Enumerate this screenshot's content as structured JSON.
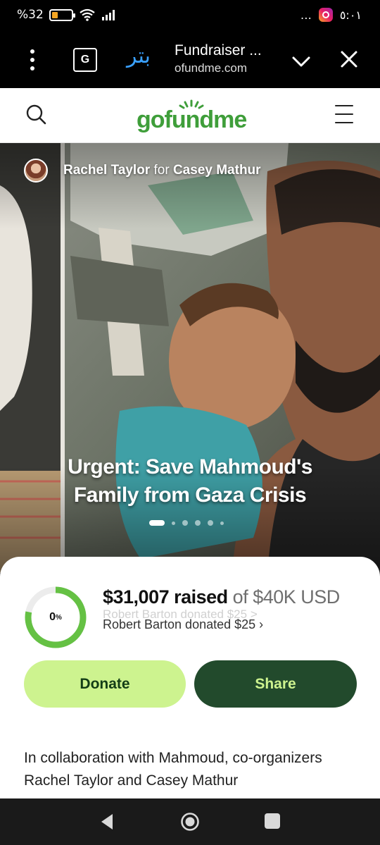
{
  "status_bar": {
    "battery": "%32",
    "battery_level": 0.32,
    "time": "٥:٠١",
    "overflow": "…"
  },
  "browser": {
    "site_logo": "بتر",
    "tab_title": "Fundraiser ...",
    "url": "ofundme.com",
    "translate_glyph": "G"
  },
  "site_header": {
    "logo_text": "gofundme"
  },
  "hero": {
    "organizer": "Rachel Taylor",
    "for_label": "for",
    "beneficiary": "Casey Mathur",
    "title_line1": "Urgent: Save Mahmoud's",
    "title_line2": "Family from Gaza Crisis",
    "slide_count": 6,
    "active_slide": 1
  },
  "progress": {
    "percent_label": "0",
    "percent_sign": "%",
    "ring_fill_fraction": 0.78,
    "raised_amount": "$31,007 raised",
    "goal": "of $40K USD",
    "ghost_donation": "Robert Barton donated $25 >",
    "latest_donation": "Robert Barton donated $25 ›"
  },
  "actions": {
    "donate_label": "Donate",
    "share_label": "Share"
  },
  "story": {
    "text": "In collaboration with Mahmoud, co-organizers Rachel Taylor and Casey Mathur"
  },
  "colors": {
    "brand_green": "#3f9e3a",
    "donate_bg": "#cdf38f",
    "share_bg": "#224a2c"
  }
}
